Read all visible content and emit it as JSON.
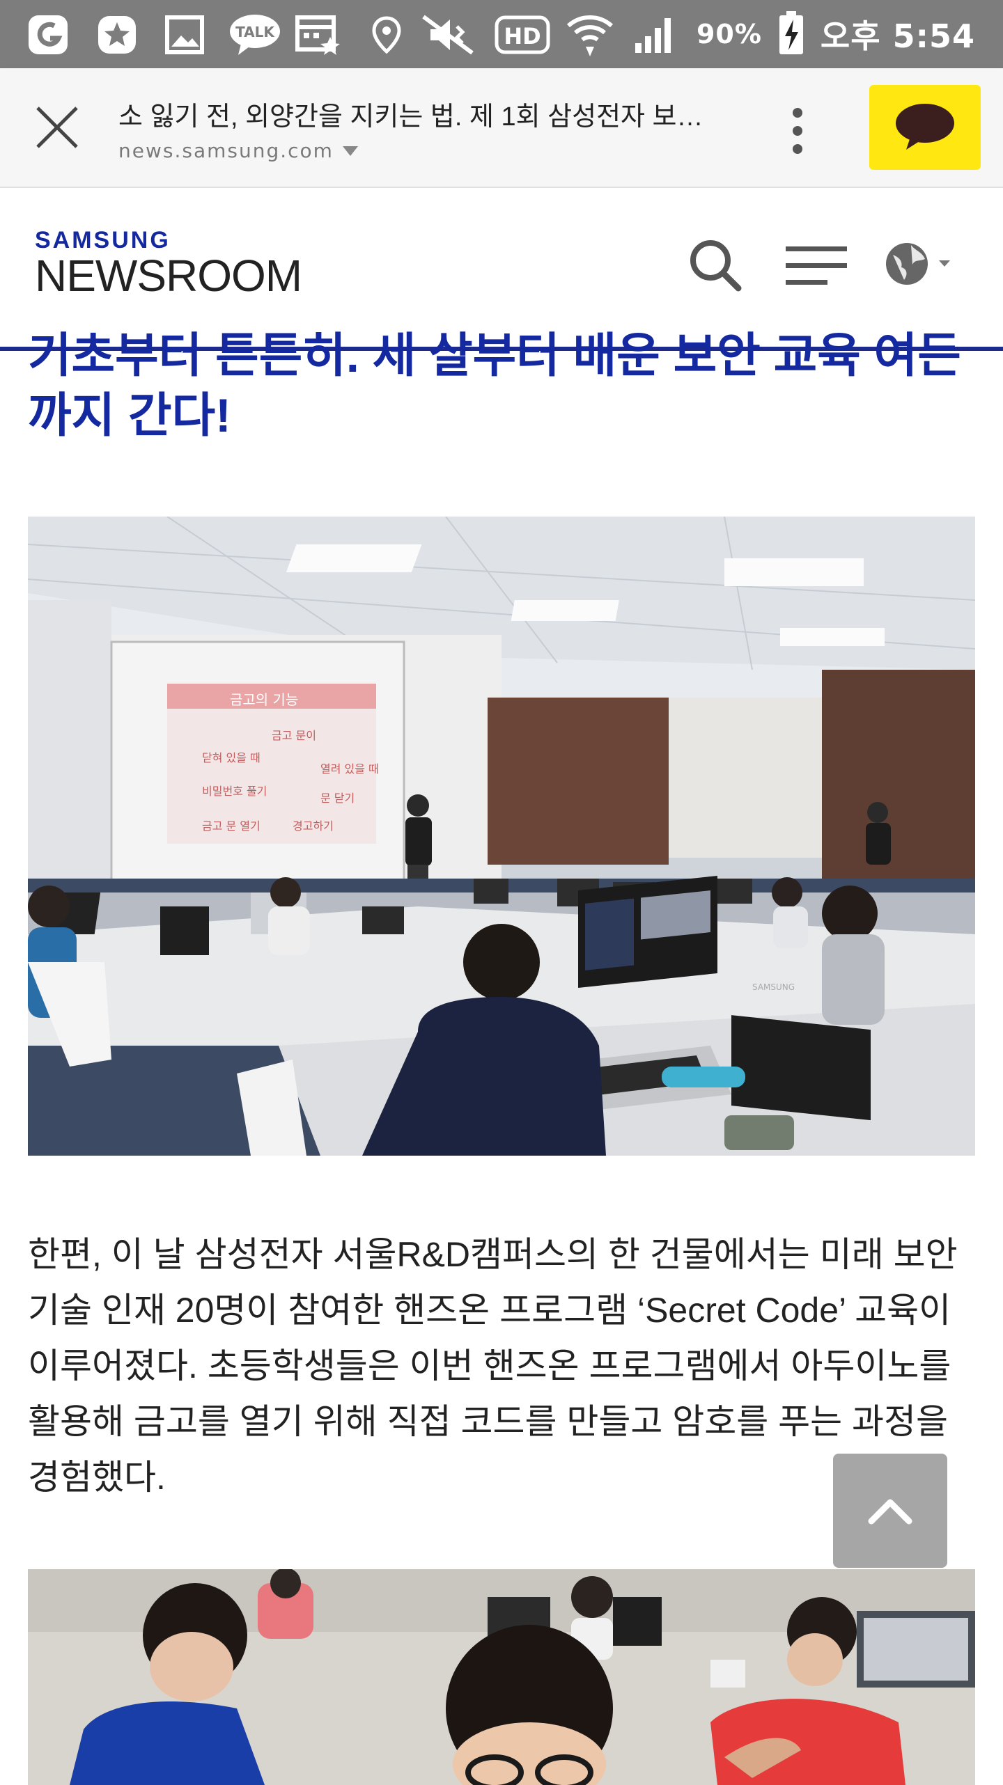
{
  "status_bar": {
    "icons": [
      "app-g-icon",
      "star-notification-icon",
      "gallery-icon",
      "kakaotalk-icon",
      "calendar-icon",
      "location-icon",
      "mute-icon",
      "hd-icon",
      "wifi-icon",
      "signal-icon",
      "battery-charging-icon"
    ],
    "hd_label": "HD",
    "talk_label": "TALK",
    "battery": "90%",
    "time": "오후 5:54"
  },
  "browser": {
    "page_title": "소 잃기 전, 외양간을 지키는 법. 제 1회 삼성전자 보…",
    "url": "news.samsung.com"
  },
  "site": {
    "brand_top": "SAMSUNG",
    "brand_bottom": "NEWSROOM"
  },
  "article": {
    "headline": "기초부터 튼튼히. 세 살부터 배운 보안 교육 여든까지 간다!",
    "paragraph": "한편, 이 날 삼성전자 서울R&D캠퍼스의 한 건물에서는 미래 보안 기술 인재 20명이 참여한 핸즈온 프로그램 ‘Secret Code’ 교육이 이루어졌다. 초등학생들은 이번 핸즈온 프로그램에서 아두이노를 활용해 금고를 열기 위해 직접 코드를 만들고 암호를 푸는 과정을 경험했다."
  },
  "photo1": {
    "slide_lines": [
      "금고의 기능",
      "금고 문이",
      "닫혀 있을 때",
      "열려 있을 때",
      "비밀번호 풀기",
      "문 닫기",
      "금고 문 열기",
      "경고하기"
    ],
    "laptop_brand": "SAMSUNG"
  },
  "colors": {
    "status_bar": "#7d7d7d",
    "kakao_yellow": "#ffe812",
    "samsung_blue": "#1428a0",
    "header_rule": "#1c2a8e"
  }
}
